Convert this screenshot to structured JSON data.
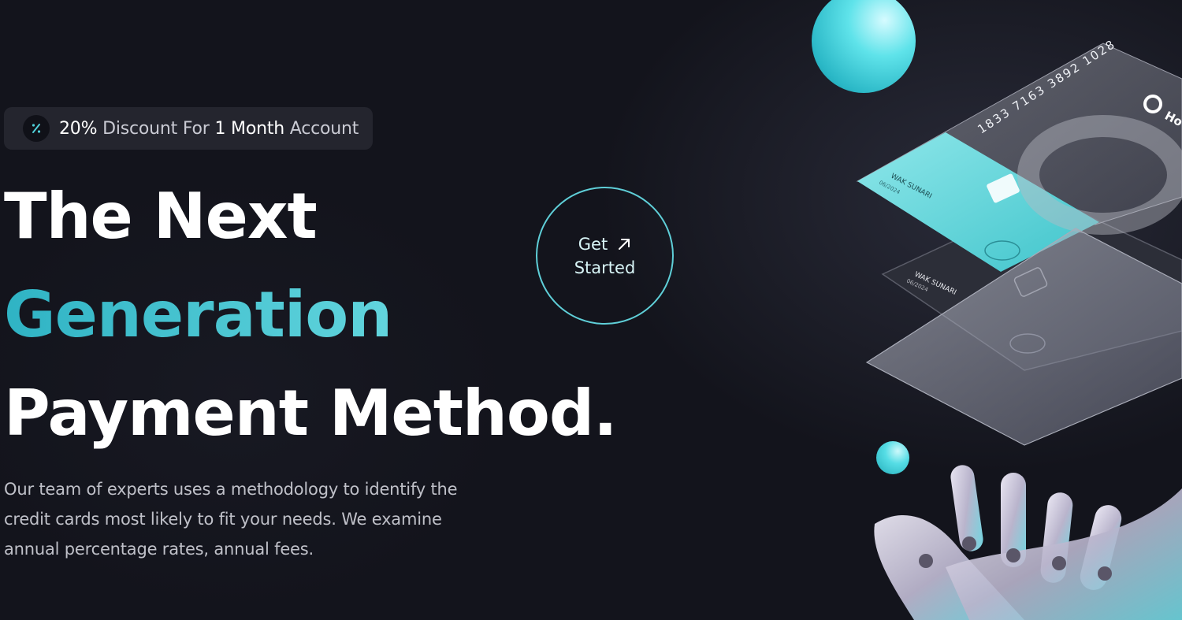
{
  "badge": {
    "icon": "percent-icon",
    "prefix_bold": "20%",
    "text_1": " Discount For ",
    "highlight": "1 Month",
    "text_2": " Account"
  },
  "hero": {
    "line1": "The Next",
    "line2": "Generation",
    "line3": "Payment Method.",
    "description": "Our team of experts uses a methodology to identify the credit cards most likely to fit your needs. We examine annual percentage rates, annual fees."
  },
  "cta": {
    "line1": "Get",
    "line2": "Started",
    "icon": "arrow-up-right-icon"
  },
  "cards": {
    "number": "1833 7163 3892 1028",
    "holder_name": "WAK SUNARI",
    "expiry": "06/2024",
    "brand": "Ho"
  },
  "colors": {
    "background": "#13141c",
    "accent": "#5fd3dc",
    "badge_bg": "#24252e"
  }
}
